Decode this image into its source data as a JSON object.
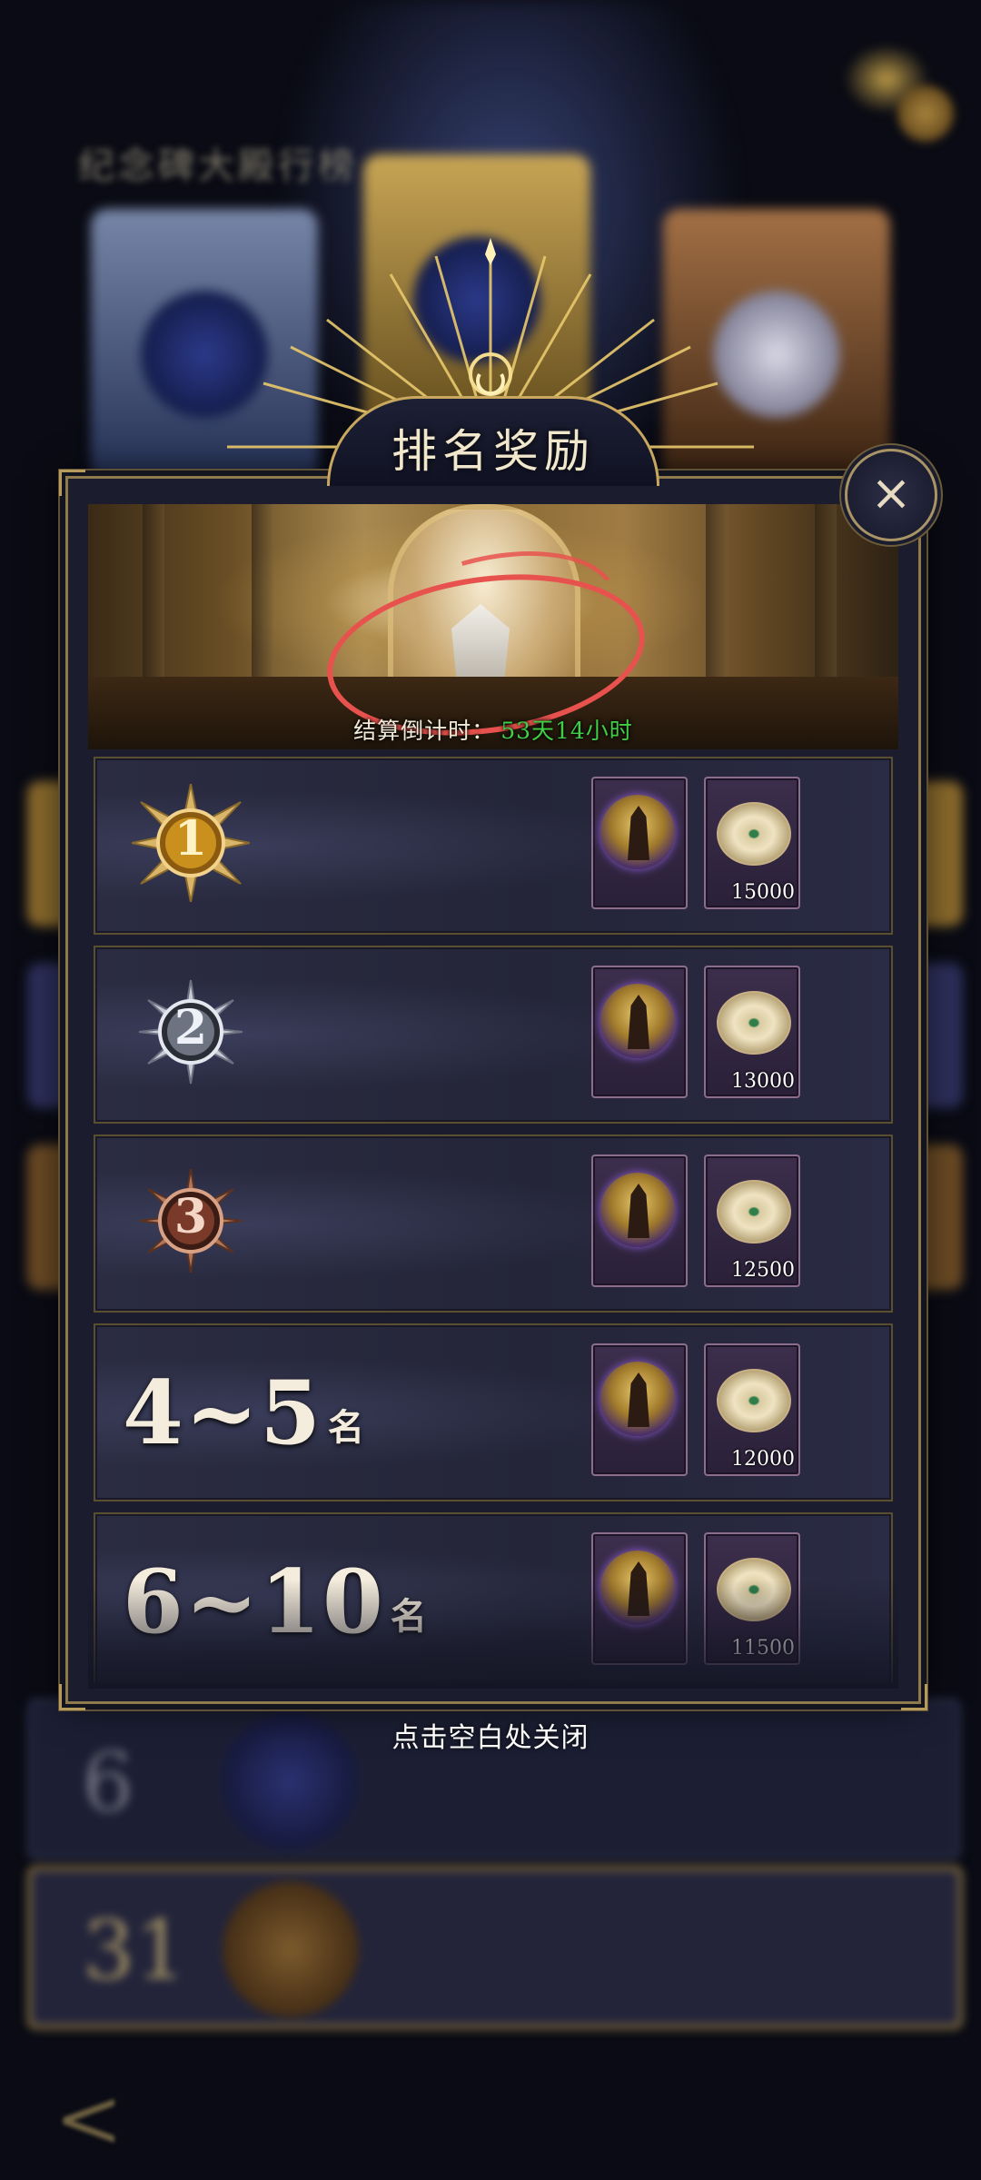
{
  "background": {
    "blurred_title": "纪念碑大殿行榜",
    "blurred_rows": [
      {
        "rank": "6"
      },
      {
        "rank": "31"
      }
    ],
    "back_glyph": "<"
  },
  "modal": {
    "title": "排名奖励",
    "close_icon": "×",
    "countdown_label": "结算倒计时：",
    "countdown_value": "53天14小时",
    "rows": [
      {
        "rank": "1",
        "rank_style": "gold",
        "items": [
          {
            "type": "hero-card"
          },
          {
            "type": "coin",
            "qty": "15000"
          }
        ]
      },
      {
        "rank": "2",
        "rank_style": "silver",
        "items": [
          {
            "type": "hero-card"
          },
          {
            "type": "coin",
            "qty": "13000"
          }
        ]
      },
      {
        "rank": "3",
        "rank_style": "bronze",
        "items": [
          {
            "type": "hero-card"
          },
          {
            "type": "coin",
            "qty": "12500"
          }
        ]
      },
      {
        "rank_range": "4~5",
        "rank_suffix": "名",
        "items": [
          {
            "type": "hero-card"
          },
          {
            "type": "coin",
            "qty": "12000"
          }
        ]
      },
      {
        "rank_range": "6~10",
        "rank_suffix": "名",
        "items": [
          {
            "type": "hero-card"
          },
          {
            "type": "coin",
            "qty": "11500"
          }
        ]
      }
    ],
    "footer_hint": "点击空白处关闭"
  },
  "colors": {
    "countdown_value": "#3fce45",
    "frame_gold": "#c9a75e",
    "annotation_red": "#e8524e"
  }
}
